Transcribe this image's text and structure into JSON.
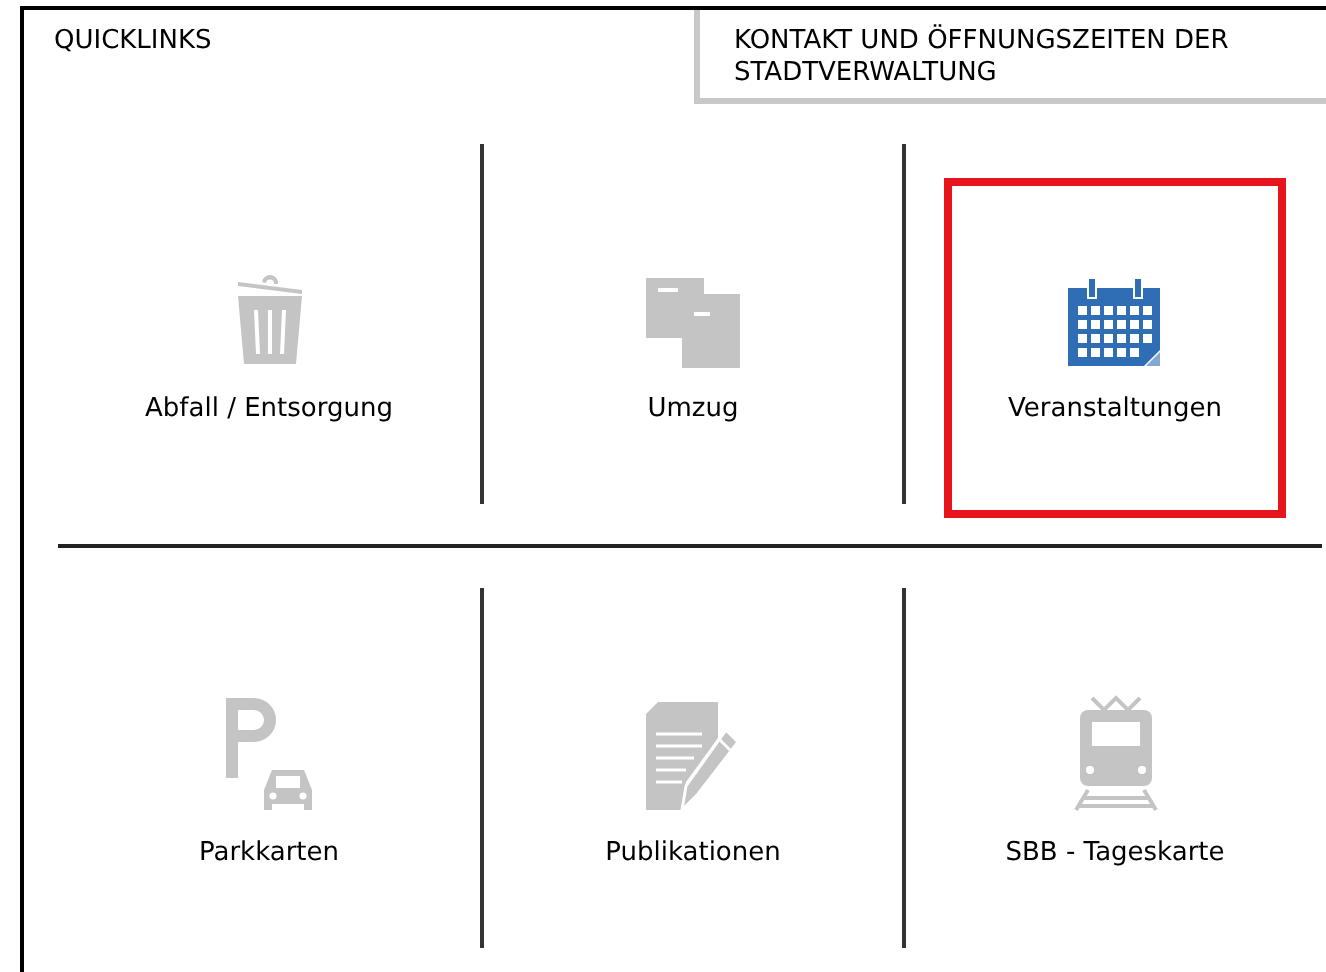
{
  "tabs": [
    {
      "label": "QUICKLINKS",
      "selected": true
    },
    {
      "label": "KONTAKT UND ÖFFNUNGSZEITEN DER STADTVERWALTUNG",
      "selected": false
    }
  ],
  "quicklinks": [
    [
      {
        "label": "Abfall / Entsorgung",
        "kind": "trash",
        "selected": false
      },
      {
        "label": "Umzug",
        "kind": "documents",
        "selected": false
      },
      {
        "label": "Veranstaltungen",
        "kind": "calendar",
        "selected": true
      }
    ],
    [
      {
        "label": "Parkkarten",
        "kind": "parking",
        "selected": false
      },
      {
        "label": "Publikationen",
        "kind": "document-edit",
        "selected": false
      },
      {
        "label": "SBB - Tageskarte",
        "kind": "train",
        "selected": false
      }
    ]
  ]
}
